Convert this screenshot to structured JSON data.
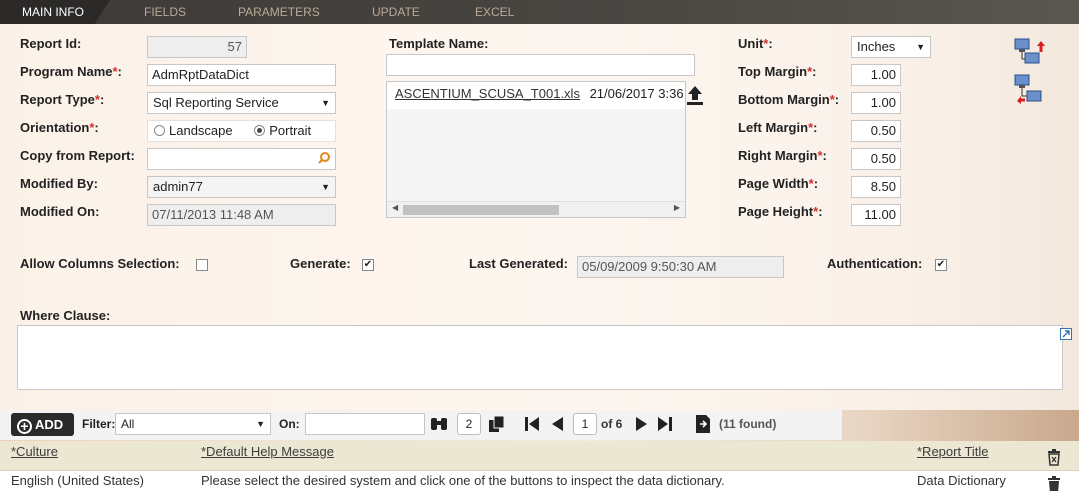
{
  "tabs": [
    {
      "label": "MAIN INFO"
    },
    {
      "label": "FIELDS"
    },
    {
      "label": "PARAMETERS"
    },
    {
      "label": "UPDATE"
    },
    {
      "label": "EXCEL"
    }
  ],
  "form": {
    "report_id": {
      "label": "Report Id:",
      "value": "57"
    },
    "program_name": {
      "label": "Program Name",
      "value": "AdmRptDataDict"
    },
    "report_type": {
      "label": "Report Type",
      "value": "Sql Reporting Service"
    },
    "orientation": {
      "label": "Orientation",
      "option_landscape": "Landscape",
      "option_portrait": "Portrait",
      "selected": "Portrait"
    },
    "copy_from_report": {
      "label": "Copy from Report:",
      "value": ""
    },
    "modified_by": {
      "label": "Modified By:",
      "value": "admin77"
    },
    "modified_on": {
      "label": "Modified On:",
      "value": "07/11/2013 11:48 AM"
    },
    "template_name": {
      "label": "Template Name:",
      "value": "",
      "file_name": "ASCENTIUM_SCUSA_T001.xls",
      "file_date": "21/06/2017 3:36"
    },
    "unit": {
      "label": "Unit",
      "value": "Inches"
    },
    "top_margin": {
      "label": "Top Margin",
      "value": "1.00"
    },
    "bottom_margin": {
      "label": "Bottom Margin",
      "value": "1.00"
    },
    "left_margin": {
      "label": "Left Margin",
      "value": "0.50"
    },
    "right_margin": {
      "label": "Right Margin",
      "value": "0.50"
    },
    "page_width": {
      "label": "Page Width",
      "value": "8.50"
    },
    "page_height": {
      "label": "Page Height",
      "value": "11.00"
    },
    "allow_columns_selection": {
      "label": "Allow Columns Selection:",
      "checked": false
    },
    "generate": {
      "label": "Generate:",
      "checked": true
    },
    "last_generated": {
      "label": "Last Generated:",
      "value": "05/09/2009 9:50:30 AM"
    },
    "authentication": {
      "label": "Authentication:",
      "checked": true
    },
    "where_clause": {
      "label": "Where Clause:",
      "value": ""
    },
    "required_marker": "*",
    "colon": ":"
  },
  "toolbar": {
    "add_label": "ADD",
    "filter_label": "Filter:",
    "filter_value": "All",
    "on_label": "On:",
    "on_value": "",
    "rows_per_page": "2",
    "current_page": "1",
    "of_pages": "of 6",
    "found": "(11 found)"
  },
  "grid": {
    "columns": [
      "*Culture",
      "*Default Help Message",
      "*Report Title"
    ],
    "rows": [
      {
        "culture": "English (United States)",
        "message": "Please select the desired system and click one of the buttons to inspect the data dictionary.",
        "title": "Data Dictionary"
      }
    ]
  },
  "icons": {
    "search": "search-icon",
    "upload": "upload-icon",
    "network_up": "network-upload-icon",
    "network_down": "network-download-icon",
    "binoculars": "binoculars-icon",
    "copy": "copy-icon",
    "first": "first-page-icon",
    "prev": "prev-page-icon",
    "next": "next-page-icon",
    "last": "last-page-icon",
    "export": "export-icon",
    "delete": "trash-icon",
    "expand": "expand-icon"
  }
}
